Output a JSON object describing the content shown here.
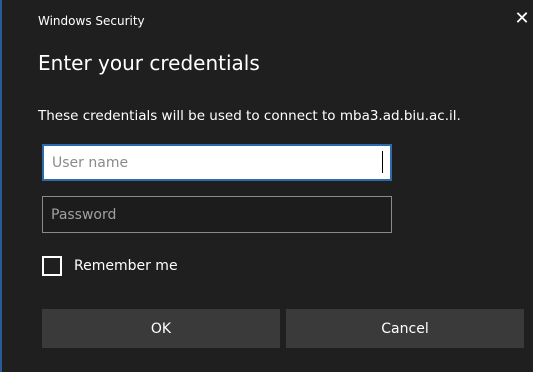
{
  "window": {
    "title": "Windows Security",
    "close_glyph": "✕"
  },
  "dialog": {
    "heading": "Enter your credentials",
    "description": "These credentials will be used to connect to mba3.ad.biu.ac.il."
  },
  "form": {
    "username": {
      "placeholder": "User name",
      "value": ""
    },
    "password": {
      "placeholder": "Password",
      "value": ""
    },
    "remember": {
      "label": "Remember me",
      "checked": false
    }
  },
  "buttons": {
    "ok_label": "OK",
    "cancel_label": "Cancel"
  },
  "colors": {
    "background": "#1f1f1f",
    "accent": "#2d6ab0",
    "button": "#3a3a3a"
  }
}
